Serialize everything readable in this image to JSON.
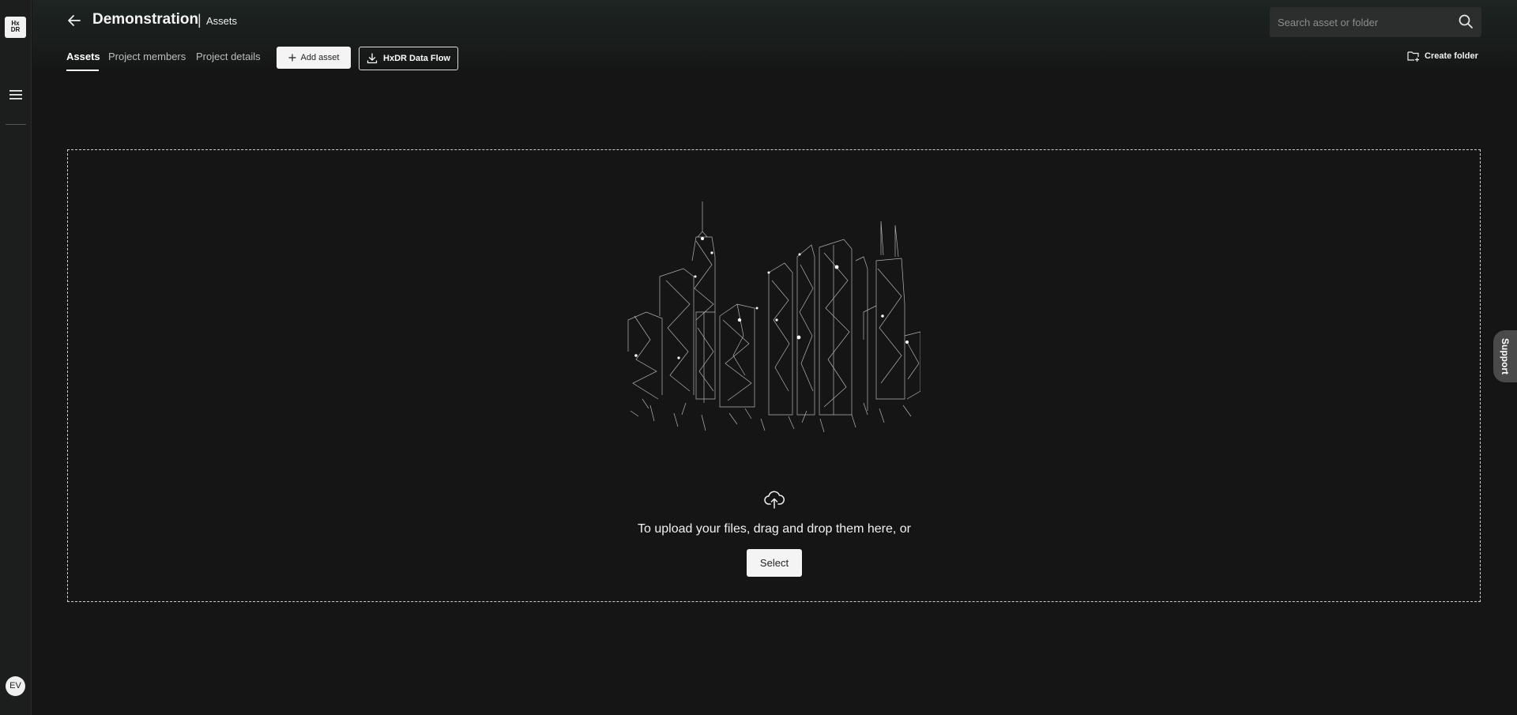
{
  "sidebar": {
    "logo_text_line1": "Hx",
    "logo_text_line2": "DR",
    "avatar_initials": "EV"
  },
  "header": {
    "title": "Demonstration",
    "separator": "|",
    "subtitle": "Assets"
  },
  "tabs": [
    {
      "label": "Assets",
      "active": true
    },
    {
      "label": "Project members",
      "active": false
    },
    {
      "label": "Project details",
      "active": false
    }
  ],
  "toolbar": {
    "add_asset_label": "Add asset",
    "data_flow_label": "HxDR Data Flow",
    "create_folder_label": "Create folder"
  },
  "search": {
    "placeholder": "Search asset or folder"
  },
  "dropzone": {
    "message": "To upload your files, drag and drop them here, or",
    "select_label": "Select"
  },
  "support": {
    "label": "Support"
  },
  "colors": {
    "background": "#151515",
    "sidebar": "#1c1d1d",
    "header_gradient_top": "#1d2422",
    "search_bg": "#2c2d2d",
    "support_tab": "#4a4a4a"
  }
}
